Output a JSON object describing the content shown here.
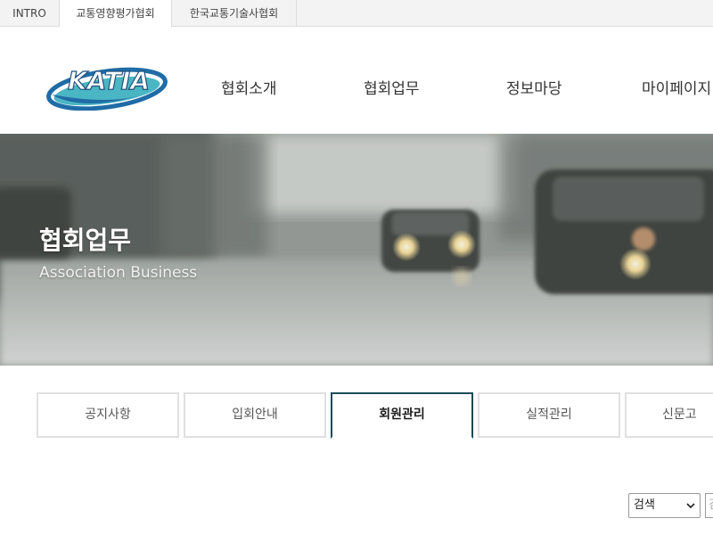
{
  "top_tabs": [
    {
      "label": "INTRO"
    },
    {
      "label": "교통영향평가협회"
    },
    {
      "label": "한국교통기술사협회"
    }
  ],
  "logo": {
    "text": "KATIA"
  },
  "nav": [
    {
      "label": "협회소개"
    },
    {
      "label": "협회업무"
    },
    {
      "label": "정보마당"
    },
    {
      "label": "마이페이지"
    }
  ],
  "hero": {
    "title": "협회업무",
    "subtitle": "Association Business"
  },
  "sub_tabs": [
    {
      "label": "공지사항"
    },
    {
      "label": "입회안내"
    },
    {
      "label": "회원관리"
    },
    {
      "label": "실적관리"
    },
    {
      "label": "신문고"
    }
  ],
  "active_sub_tab": "회원관리",
  "search": {
    "select_value": "검색",
    "input_placeholder": "검색어"
  },
  "colors": {
    "accent": "#1e4a5a",
    "logo_blue": "#1f6ca6",
    "logo_teal": "#2aa9b8"
  }
}
